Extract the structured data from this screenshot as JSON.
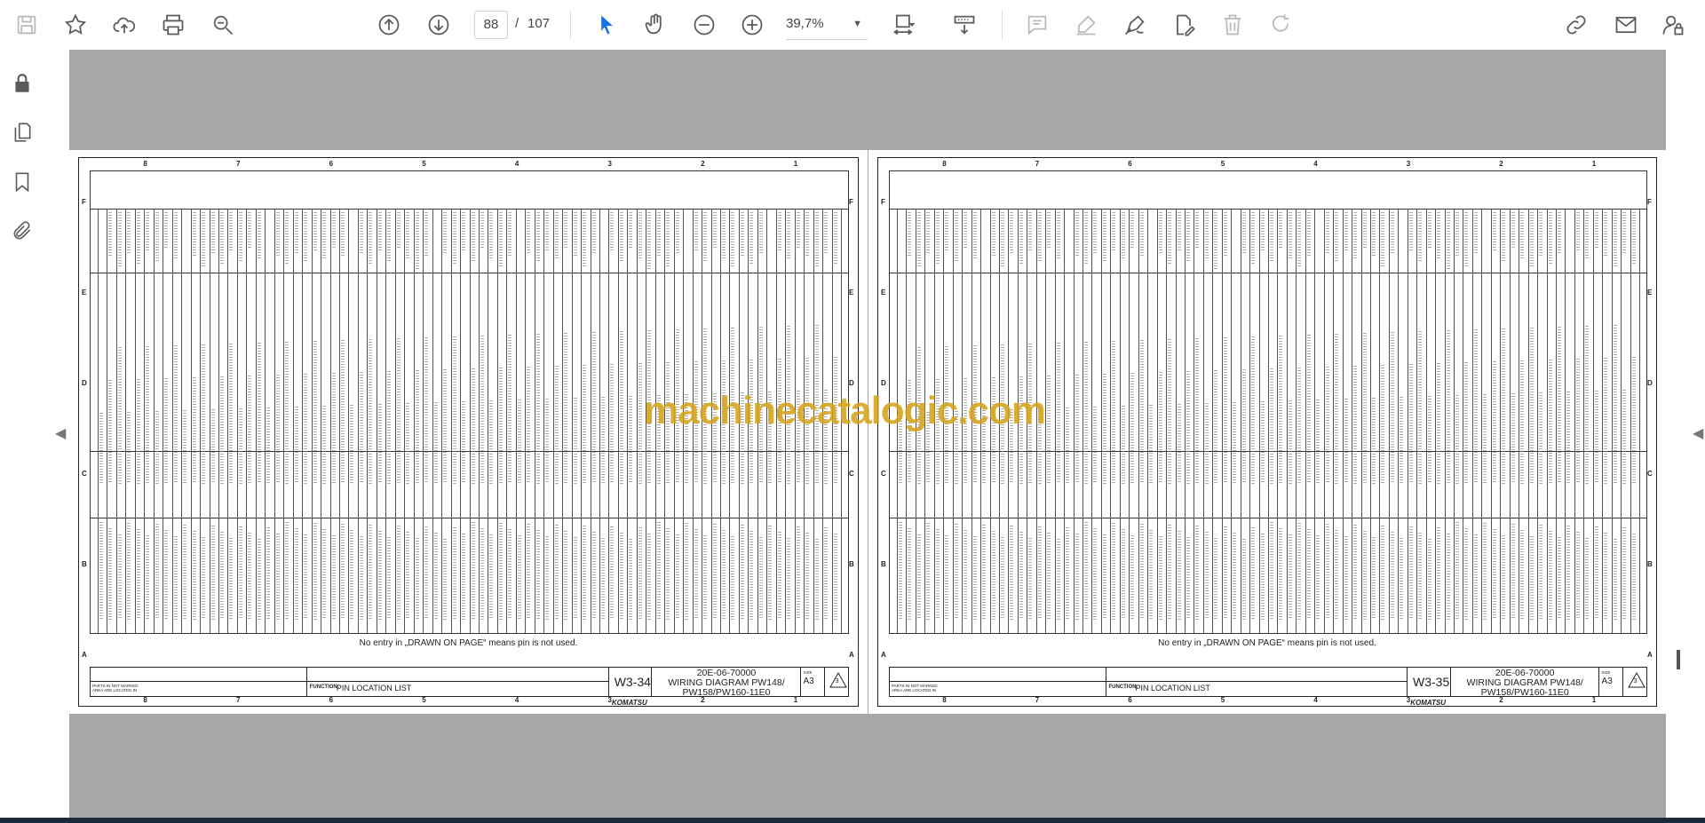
{
  "toolbar": {
    "page_current": "88",
    "page_separator": "/",
    "page_total": "107",
    "zoom_value": "39,7%"
  },
  "document": {
    "watermark": "machinecatalogic.com",
    "pages": [
      {
        "page_code": "W3-34",
        "doc_number": "20E-06-70000",
        "doc_title_1": "WIRING DIAGRAM PW148/",
        "doc_title_2": "PW158/PW160-11E0",
        "function_label": "FUNCTION:",
        "function_value": "PIN LOCATION LIST",
        "note": "No entry in „DRAWN ON PAGE“ means pin is not used.",
        "size_label": "SIZE",
        "size_value": "A3",
        "parts_note_1": "PARTS IN NOT MARKED",
        "parts_note_2": "AREA ARE LOCATED IN",
        "brand": "KOMATSU",
        "rev": "3"
      },
      {
        "page_code": "W3-35",
        "doc_number": "20E-06-70000",
        "doc_title_1": "WIRING DIAGRAM PW148/",
        "doc_title_2": "PW158/PW160-11E0",
        "function_label": "FUNCTION:",
        "function_value": "PIN LOCATION LIST",
        "note": "No entry in „DRAWN ON PAGE“ means pin is not used.",
        "size_label": "SIZE",
        "size_value": "A3",
        "parts_note_1": "PARTS IN NOT MARKED",
        "parts_note_2": "AREA ARE LOCATED IN",
        "brand": "KOMATSU",
        "rev": "3"
      }
    ],
    "col_numbers": [
      "8",
      "7",
      "6",
      "5",
      "4",
      "3",
      "2",
      "1"
    ],
    "row_letters": [
      "F",
      "E",
      "D",
      "C",
      "B",
      "A"
    ]
  },
  "icons": {
    "save": "save-icon",
    "bookmark_star": "star-icon",
    "upload": "cloud-upload-icon",
    "print": "print-icon",
    "find": "zoom-search-icon",
    "prev": "arrow-up-circle-icon",
    "next": "arrow-down-circle-icon",
    "select": "cursor-arrow-icon",
    "hand": "hand-icon",
    "zoom_out": "minus-circle-icon",
    "zoom_in": "plus-circle-icon"
  }
}
